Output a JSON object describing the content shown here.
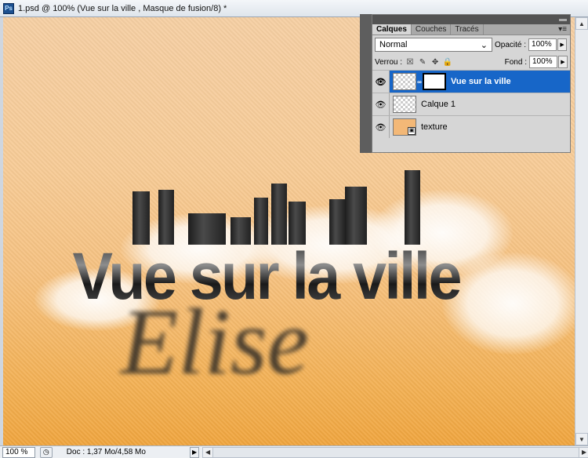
{
  "window": {
    "title": "1.psd @ 100% (Vue sur la ville , Masque de fusion/8) *",
    "app_badge": "Ps"
  },
  "artwork": {
    "headline": "Vue sur la ville",
    "name": "Elise"
  },
  "layers_panel": {
    "tabs": [
      {
        "label": "Calques",
        "active": true
      },
      {
        "label": "Couches",
        "active": false
      },
      {
        "label": "Tracés",
        "active": false
      }
    ],
    "blend_mode": "Normal",
    "opacity_label": "Opacité :",
    "opacity_value": "100%",
    "lock_label": "Verrou :",
    "fill_label": "Fond :",
    "fill_value": "100%",
    "layers": [
      {
        "name": "Vue sur la ville",
        "selected": true,
        "has_mask": true
      },
      {
        "name": "Calque 1",
        "selected": false,
        "has_mask": false
      },
      {
        "name": "texture",
        "selected": false,
        "has_mask": false,
        "smart_object": true
      }
    ]
  },
  "status_bar": {
    "zoom": "100 %",
    "doc_info": "Doc : 1,37 Mo/4,58 Mo"
  },
  "colors": {
    "selection": "#1766c8",
    "canvas_top": "#f6cfa3",
    "canvas_bottom": "#f0a53e"
  }
}
